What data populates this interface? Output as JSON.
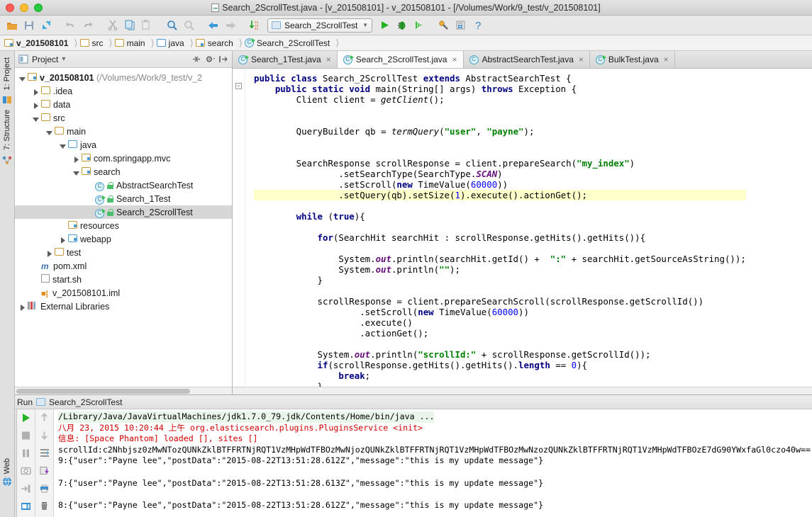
{
  "window": {
    "title": "Search_2ScrollTest.java - [v_201508101] - v_201508101 - [/Volumes/Work/9_test/v_201508101]",
    "title_icon": "java-file-icon"
  },
  "toolbar": {
    "buttons": [
      {
        "name": "open-folder-icon",
        "label": "Open"
      },
      {
        "name": "save-all-icon",
        "label": "Save All"
      },
      {
        "name": "sync-icon",
        "label": "Synchronize"
      },
      {
        "name": "undo-icon",
        "label": "Undo"
      },
      {
        "name": "redo-icon",
        "label": "Redo"
      },
      {
        "name": "cut-icon",
        "label": "Cut"
      },
      {
        "name": "copy-icon",
        "label": "Copy"
      },
      {
        "name": "paste-icon",
        "label": "Paste"
      },
      {
        "name": "find-icon",
        "label": "Find"
      },
      {
        "name": "replace-icon",
        "label": "Replace"
      },
      {
        "name": "back-icon",
        "label": "Back"
      },
      {
        "name": "forward-icon",
        "label": "Forward"
      },
      {
        "name": "compile-icon",
        "label": "Compile"
      }
    ],
    "run_config": "Search_2ScrollTest",
    "right_buttons": [
      {
        "name": "run-icon",
        "label": "Run"
      },
      {
        "name": "debug-icon",
        "label": "Debug"
      },
      {
        "name": "run-coverage-icon",
        "label": "Run with Coverage"
      },
      {
        "name": "settings-wrench-icon",
        "label": "Project Structure"
      },
      {
        "name": "preferences-icon",
        "label": "Preferences"
      },
      {
        "name": "help-icon",
        "label": "Help"
      }
    ]
  },
  "breadcrumb": [
    {
      "label": "v_201508101",
      "icon": "module-folder-icon"
    },
    {
      "label": "src",
      "icon": "folder-icon"
    },
    {
      "label": "main",
      "icon": "folder-icon"
    },
    {
      "label": "java",
      "icon": "source-folder-icon"
    },
    {
      "label": "search",
      "icon": "package-icon"
    },
    {
      "label": "Search_2ScrollTest",
      "icon": "java-class-runnable-icon"
    }
  ],
  "left_rail": [
    {
      "label": "1: Project",
      "icon": "project-icon"
    },
    {
      "label": "7: Structure",
      "icon": "structure-icon"
    }
  ],
  "bottom_rail": [
    {
      "label": "Web",
      "icon": "web-icon"
    }
  ],
  "project_panel": {
    "title": "Project",
    "caret": "▾",
    "tools": [
      {
        "name": "collapse-all-icon"
      },
      {
        "name": "settings-gear-icon"
      },
      {
        "name": "autoscroll-icon"
      }
    ],
    "tree": [
      {
        "indent": 0,
        "twisty": "open",
        "icon": "module-folder-icon",
        "label": "v_201508101",
        "suffix": "(/Volumes/Work/9_test/v_2",
        "bold": true,
        "selected": false,
        "lock": false
      },
      {
        "indent": 1,
        "twisty": "closed",
        "icon": "folder-icon",
        "label": ".idea",
        "suffix": "",
        "bold": false,
        "selected": false,
        "lock": false
      },
      {
        "indent": 1,
        "twisty": "closed",
        "icon": "folder-icon",
        "label": "data",
        "suffix": "",
        "bold": false,
        "selected": false,
        "lock": false
      },
      {
        "indent": 1,
        "twisty": "open",
        "icon": "folder-icon",
        "label": "src",
        "suffix": "",
        "bold": false,
        "selected": false,
        "lock": false
      },
      {
        "indent": 2,
        "twisty": "open",
        "icon": "folder-icon",
        "label": "main",
        "suffix": "",
        "bold": false,
        "selected": false,
        "lock": false
      },
      {
        "indent": 3,
        "twisty": "open",
        "icon": "source-folder-icon",
        "label": "java",
        "suffix": "",
        "bold": false,
        "selected": false,
        "lock": false
      },
      {
        "indent": 4,
        "twisty": "closed",
        "icon": "package-icon",
        "label": "com.springapp.mvc",
        "suffix": "",
        "bold": false,
        "selected": false,
        "lock": false
      },
      {
        "indent": 4,
        "twisty": "open",
        "icon": "package-icon",
        "label": "search",
        "suffix": "",
        "bold": false,
        "selected": false,
        "lock": false
      },
      {
        "indent": 5,
        "twisty": "none",
        "icon": "java-class-icon",
        "label": "AbstractSearchTest",
        "suffix": "",
        "bold": false,
        "selected": false,
        "lock": true
      },
      {
        "indent": 5,
        "twisty": "none",
        "icon": "java-class-runnable-icon",
        "label": "Search_1Test",
        "suffix": "",
        "bold": false,
        "selected": false,
        "lock": true
      },
      {
        "indent": 5,
        "twisty": "none",
        "icon": "java-class-runnable-icon",
        "label": "Search_2ScrollTest",
        "suffix": "",
        "bold": false,
        "selected": true,
        "lock": true
      },
      {
        "indent": 3,
        "twisty": "none",
        "icon": "resources-folder-icon",
        "label": "resources",
        "suffix": "",
        "bold": false,
        "selected": false,
        "lock": false
      },
      {
        "indent": 3,
        "twisty": "closed",
        "icon": "webapp-folder-icon",
        "label": "webapp",
        "suffix": "",
        "bold": false,
        "selected": false,
        "lock": false
      },
      {
        "indent": 2,
        "twisty": "closed",
        "icon": "folder-icon",
        "label": "test",
        "suffix": "",
        "bold": false,
        "selected": false,
        "lock": false
      },
      {
        "indent": 1,
        "twisty": "none",
        "icon": "maven-pom-icon",
        "label": "pom.xml",
        "suffix": "",
        "bold": false,
        "selected": false,
        "lock": false
      },
      {
        "indent": 1,
        "twisty": "none",
        "icon": "shell-file-icon",
        "label": "start.sh",
        "suffix": "",
        "bold": false,
        "selected": false,
        "lock": false
      },
      {
        "indent": 1,
        "twisty": "none",
        "icon": "iml-file-icon",
        "label": "v_201508101.iml",
        "suffix": "",
        "bold": false,
        "selected": false,
        "lock": false
      },
      {
        "indent": 0,
        "twisty": "closed",
        "icon": "libraries-icon",
        "label": "External Libraries",
        "suffix": "",
        "bold": false,
        "selected": false,
        "lock": false
      }
    ]
  },
  "editor": {
    "tabs": [
      {
        "label": "Search_1Test.java",
        "icon": "java-class-runnable-icon",
        "active": false,
        "close": "×"
      },
      {
        "label": "Search_2ScrollTest.java",
        "icon": "java-class-runnable-icon",
        "active": true,
        "close": "×"
      },
      {
        "label": "AbstractSearchTest.java",
        "icon": "java-class-icon",
        "active": false,
        "close": "×"
      },
      {
        "label": "BulkTest.java",
        "icon": "java-class-runnable-icon",
        "active": false,
        "close": "×"
      }
    ],
    "code_lines": [
      {
        "t": "plain",
        "html": "<span class=\"kw\">public class</span> Search_2ScrollTest <span class=\"kw\">extends</span> AbstractSearchTest {"
      },
      {
        "t": "plain",
        "html": "    <span class=\"kw\">public static void</span> main(String[] args) <span class=\"kw\">throws</span> Exception {"
      },
      {
        "t": "plain",
        "html": "        Client client = <span class=\"mth\">getClient</span>();"
      },
      {
        "t": "plain",
        "html": ""
      },
      {
        "t": "plain",
        "html": ""
      },
      {
        "t": "plain",
        "html": "        QueryBuilder qb = <span class=\"mth\">termQuery</span>(<span class=\"str\">\"user\"</span>, <span class=\"str\">\"payne\"</span>);"
      },
      {
        "t": "plain",
        "html": ""
      },
      {
        "t": "plain",
        "html": ""
      },
      {
        "t": "plain",
        "html": "        SearchResponse scrollResponse = client.prepareSearch(<span class=\"str\">\"my_index\"</span>)"
      },
      {
        "t": "plain",
        "html": "                .setSearchType(SearchType.<span class=\"stat\">SCAN</span>)"
      },
      {
        "t": "plain",
        "html": "                .setScroll(<span class=\"kw\">new</span> TimeValue(<span class=\"num\">60000</span>))"
      },
      {
        "t": "hl",
        "html": "                .setQuery(qb).setSize(<span class=\"num\">1</span>).execute().actionGet();"
      },
      {
        "t": "plain",
        "html": "        <span class=\"kw\">while</span> (<span class=\"kw\">true</span>){"
      },
      {
        "t": "plain",
        "html": ""
      },
      {
        "t": "plain",
        "html": "            <span class=\"kw\">for</span>(SearchHit searchHit : scrollResponse.getHits().getHits()){"
      },
      {
        "t": "plain",
        "html": ""
      },
      {
        "t": "plain",
        "html": "                System.<span class=\"fld\">out</span>.println(searchHit.getId() +  <span class=\"str\">\":\"</span> + searchHit.getSourceAsString());"
      },
      {
        "t": "plain",
        "html": "                System.<span class=\"fld\">out</span>.println(<span class=\"str\">\"\"</span>);"
      },
      {
        "t": "plain",
        "html": "            }"
      },
      {
        "t": "plain",
        "html": ""
      },
      {
        "t": "plain",
        "html": "            scrollResponse = client.prepareSearchScroll(scrollResponse.getScrollId())"
      },
      {
        "t": "plain",
        "html": "                    .setScroll(<span class=\"kw\">new</span> TimeValue(<span class=\"num\">60000</span>))"
      },
      {
        "t": "plain",
        "html": "                    .execute()"
      },
      {
        "t": "plain",
        "html": "                    .actionGet();"
      },
      {
        "t": "plain",
        "html": ""
      },
      {
        "t": "plain",
        "html": "            System.<span class=\"fld\">out</span>.println(<span class=\"str\">\"scrollId:\"</span> + scrollResponse.getScrollId());"
      },
      {
        "t": "plain",
        "html": "            <span class=\"kw\">if</span>(scrollResponse.getHits().getHits().<span class=\"kw\">length</span> == <span class=\"num\">0</span>){"
      },
      {
        "t": "plain",
        "html": "                <span class=\"kw\">break</span>;"
      },
      {
        "t": "plain",
        "html": "            }"
      },
      {
        "t": "plain",
        "html": "        }"
      }
    ]
  },
  "console": {
    "title": "Run",
    "tab_label": "Search_2ScrollTest",
    "tab_icon": "run-config-icon",
    "left_tools": [
      {
        "name": "rerun-icon"
      },
      {
        "name": "stop-icon"
      },
      {
        "name": "pause-icon"
      },
      {
        "name": "dump-icon"
      },
      {
        "name": "resume-icon"
      },
      {
        "name": "console-toggle-icon"
      }
    ],
    "right_tools": [
      {
        "name": "scroll-up-icon"
      },
      {
        "name": "scroll-down-icon"
      },
      {
        "name": "soft-wrap-icon"
      },
      {
        "name": "export-icon"
      },
      {
        "name": "print-icon"
      },
      {
        "name": "clear-all-icon"
      }
    ],
    "lines": [
      {
        "style": "green",
        "text": "/Library/Java/JavaVirtualMachines/jdk1.7.0_79.jdk/Contents/Home/bin/java ..."
      },
      {
        "style": "red",
        "text": "八月 23, 2015 10:20:44 上午 org.elasticsearch.plugins.PluginsService <init>"
      },
      {
        "style": "red",
        "text": "信息: [Space Phantom] loaded [], sites []"
      },
      {
        "style": "plain",
        "text": "scrollId:c2Nhbjsz0zMwNTozQUNkZklBTFFRTNjRQT1VzMHpWdTFBOzMwNjozQUNkZklBTFFRTNjRQT1VzMHpWdTFBOzMwNzozQUNkZklBTFFRTNjRQT1VzMHpWdTFBOzE7dG90YWxfaGl0czo40w=="
      },
      {
        "style": "plain",
        "text": "9:{\"user\":\"Payne lee\",\"postData\":\"2015-08-22T13:51:28.612Z\",\"message\":\"this is my update message\"}"
      },
      {
        "style": "plain",
        "text": ""
      },
      {
        "style": "plain",
        "text": "7:{\"user\":\"Payne lee\",\"postData\":\"2015-08-22T13:51:28.613Z\",\"message\":\"this is my update message\"}"
      },
      {
        "style": "plain",
        "text": ""
      },
      {
        "style": "plain",
        "text": "8:{\"user\":\"Payne lee\",\"postData\":\"2015-08-22T13:51:28.612Z\",\"message\":\"this is my update message\"}"
      }
    ]
  }
}
